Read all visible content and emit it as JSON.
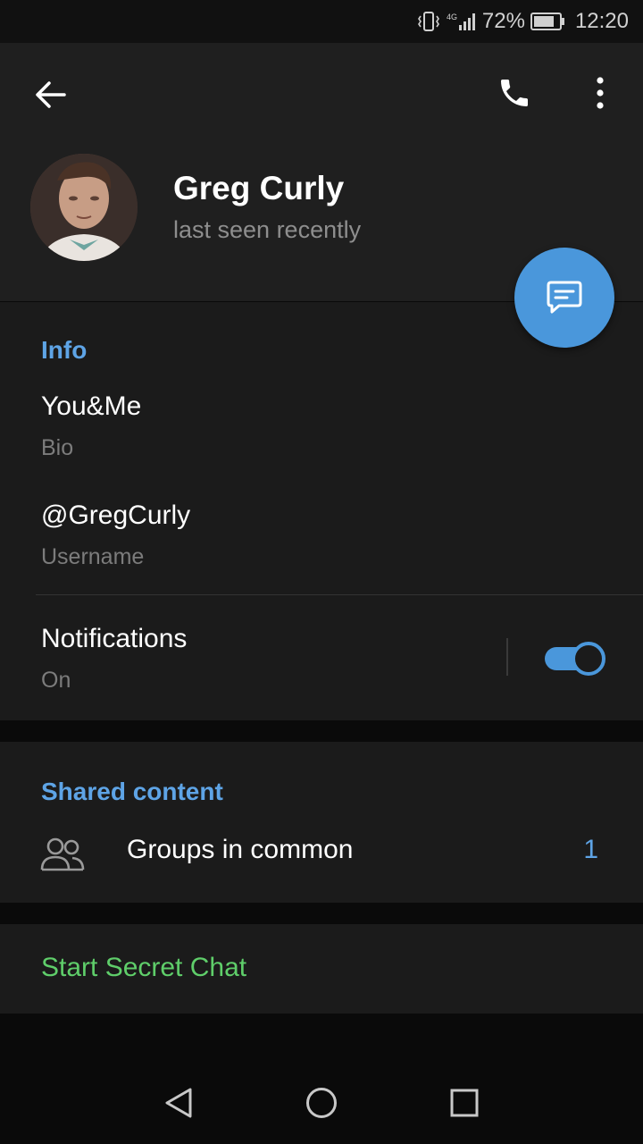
{
  "status_bar": {
    "network": "4G",
    "battery": "72%",
    "time": "12:20"
  },
  "header": {
    "name": "Greg Curly",
    "status": "last seen recently"
  },
  "info": {
    "title": "Info",
    "bio_value": "You&Me",
    "bio_label": "Bio",
    "username_value": "@GregCurly",
    "username_label": "Username",
    "notifications_value": "Notifications",
    "notifications_label": "On",
    "notifications_enabled": true
  },
  "shared": {
    "title": "Shared content",
    "groups_label": "Groups in common",
    "groups_count": "1"
  },
  "secret_chat": {
    "label": "Start Secret Chat"
  },
  "colors": {
    "accent": "#4a97db",
    "section_title": "#5ea4e6",
    "secret": "#5fce6a"
  }
}
